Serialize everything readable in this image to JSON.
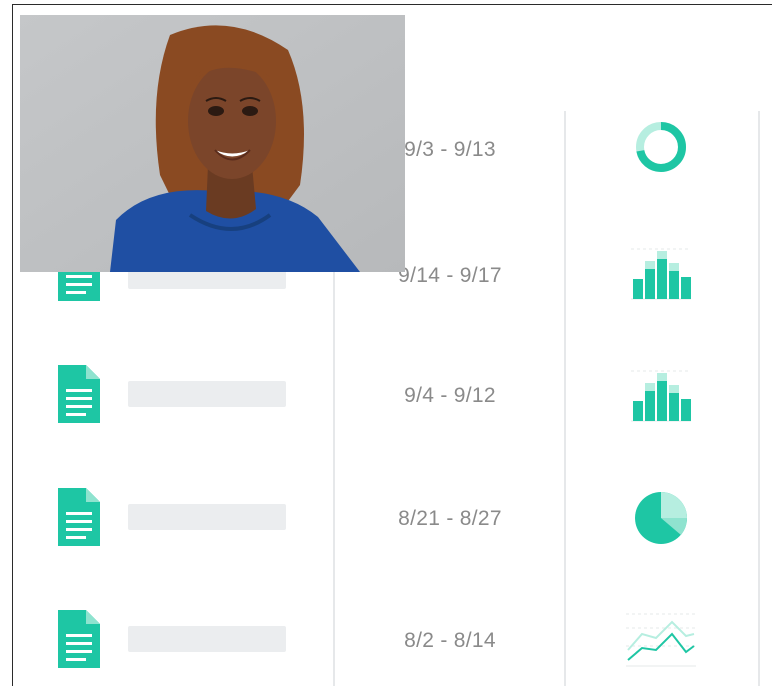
{
  "rows": [
    {
      "date_range": "9/3 - 9/13",
      "chart_icon": "donut-chart-icon"
    },
    {
      "date_range": "9/14 - 9/17",
      "chart_icon": "bar-chart-icon"
    },
    {
      "date_range": "9/4 - 9/12",
      "chart_icon": "bar-chart-icon"
    },
    {
      "date_range": "8/21 - 8/27",
      "chart_icon": "pie-chart-icon"
    },
    {
      "date_range": "8/2 - 8/14",
      "chart_icon": "line-chart-icon"
    }
  ],
  "colors": {
    "accent": "#1ec6a4",
    "accent_light": "#b6eee0",
    "placeholder": "#ebedef",
    "divider": "#e6e8ea",
    "date_text": "#8a8a8a"
  },
  "overlay": {
    "icon": "user-photo"
  }
}
